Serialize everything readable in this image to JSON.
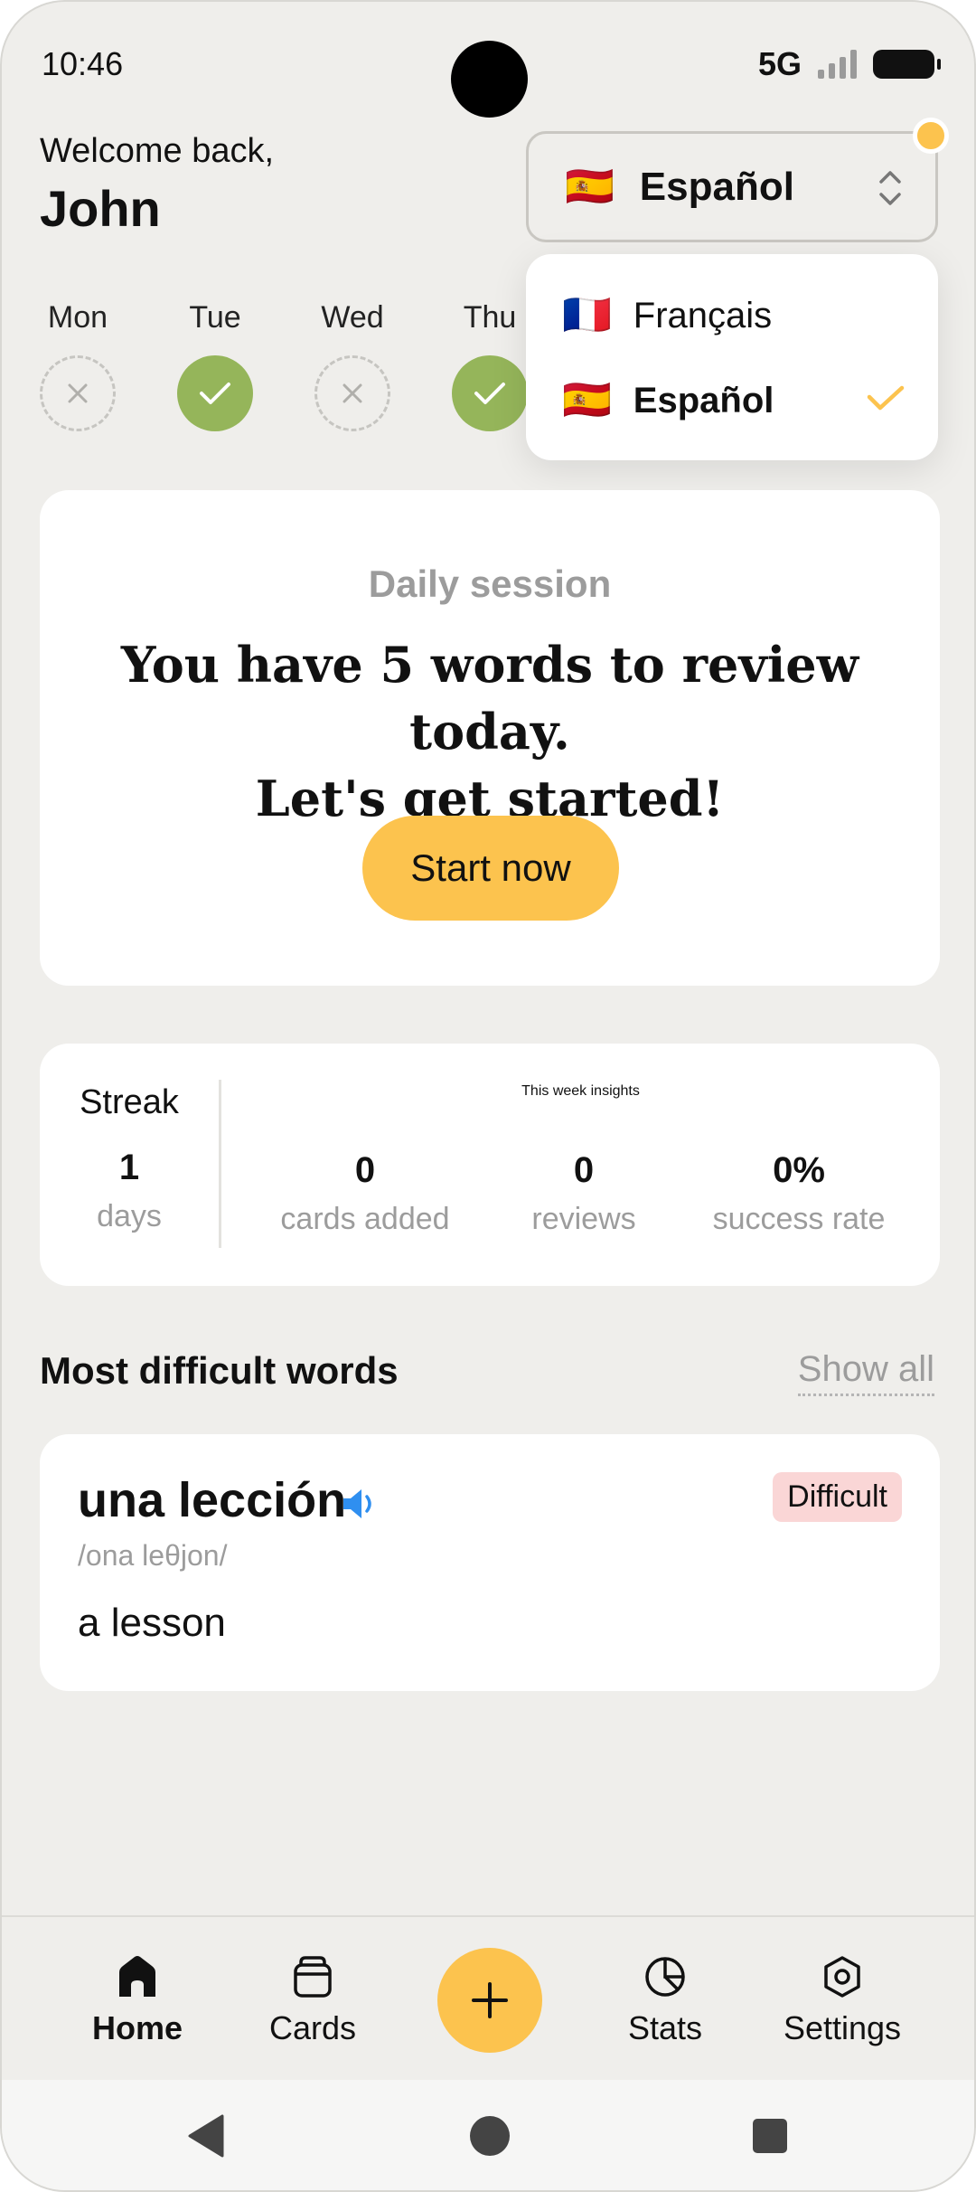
{
  "status_bar": {
    "time": "10:46",
    "network": "5G"
  },
  "header": {
    "welcome": "Welcome back,",
    "name": "John"
  },
  "language_select": {
    "selected_flag": "🇪🇸",
    "selected_label": "Español"
  },
  "language_dropdown": {
    "items": [
      {
        "flag": "🇫🇷",
        "label": "Français",
        "selected": false
      },
      {
        "flag": "🇪🇸",
        "label": "Español",
        "selected": true
      }
    ]
  },
  "week_days": [
    {
      "label": "Mon",
      "status": "missed"
    },
    {
      "label": "Tue",
      "status": "done"
    },
    {
      "label": "Wed",
      "status": "missed"
    },
    {
      "label": "Thu",
      "status": "done"
    }
  ],
  "daily_session": {
    "subtitle": "Daily session",
    "line1": "You have 5 words to review today.",
    "line2": "Let's get started!",
    "button": "Start now"
  },
  "stats": {
    "streak_title": "Streak",
    "streak_value": "1",
    "streak_unit": "days",
    "insights_title": "This week insights",
    "cards_added_value": "0",
    "cards_added_label": "cards added",
    "reviews_value": "0",
    "reviews_label": "reviews",
    "success_value": "0%",
    "success_label": "success rate"
  },
  "difficult_words": {
    "title": "Most difficult words",
    "show_all": "Show all",
    "items": [
      {
        "word": "una lección",
        "phonetic": "/ona leθjon/",
        "translation": "a lesson",
        "badge": "Difficult"
      }
    ]
  },
  "bottom_nav": {
    "home": "Home",
    "cards": "Cards",
    "stats": "Stats",
    "settings": "Settings"
  },
  "colors": {
    "accent": "#fcc34e",
    "done": "#95b55a",
    "badge_bg": "#fad6d6",
    "speaker": "#2f8ff0"
  }
}
